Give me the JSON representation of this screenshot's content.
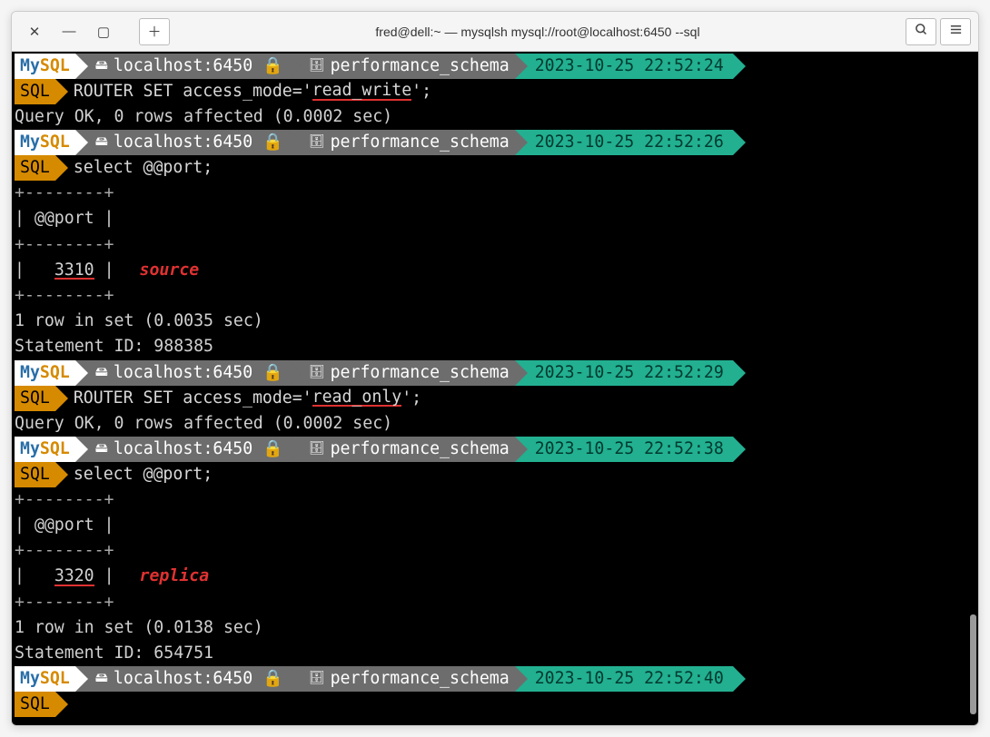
{
  "window": {
    "title": "fred@dell:~ — mysqlsh mysql://root@localhost:6450 --sql"
  },
  "prompts": [
    {
      "host": "localhost:6450",
      "schema": "performance_schema",
      "time": "2023-10-25 22:52:24"
    },
    {
      "host": "localhost:6450",
      "schema": "performance_schema",
      "time": "2023-10-25 22:52:26"
    },
    {
      "host": "localhost:6450",
      "schema": "performance_schema",
      "time": "2023-10-25 22:52:29"
    },
    {
      "host": "localhost:6450",
      "schema": "performance_schema",
      "time": "2023-10-25 22:52:38"
    },
    {
      "host": "localhost:6450",
      "schema": "performance_schema",
      "time": "2023-10-25 22:52:40"
    }
  ],
  "brand": {
    "my": "My",
    "sql": "SQL",
    "prompt_sql": "SQL"
  },
  "commands": {
    "c1_pre": "ROUTER SET access_mode='",
    "c1_ul": "read_write",
    "c1_post": "';",
    "c2": "select @@port;",
    "c3_pre": "ROUTER SET access_mode='",
    "c3_ul": "read_only",
    "c3_post": "';",
    "c4": "select @@port;"
  },
  "results": {
    "r1": "Query OK, 0 rows affected (0.0002 sec)",
    "tbl_border": "+--------+",
    "tbl_header": "| @@port |",
    "blank_row": "",
    "port1_pre": "|   ",
    "port1_val": "3310",
    "port1_post": " |",
    "ann1": "source",
    "r2a": "1 row in set (0.0035 sec)",
    "r2b": "Statement ID: 988385",
    "r3": "Query OK, 0 rows affected (0.0002 sec)",
    "port2_pre": "|   ",
    "port2_val": "3320",
    "port2_post": " |",
    "ann2": "replica",
    "r4a": "1 row in set (0.0138 sec)",
    "r4b": "Statement ID: 654751"
  }
}
